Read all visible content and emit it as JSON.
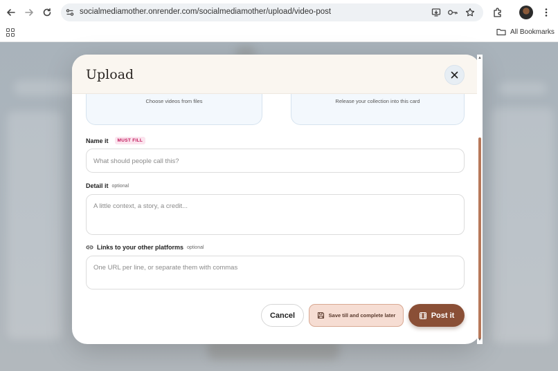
{
  "browser": {
    "url": "socialmediamother.onrender.com/socialmediamother/upload/video-post",
    "all_bookmarks": "All Bookmarks"
  },
  "modal": {
    "title": "Upload",
    "drop_zones": [
      {
        "label": "Choose videos from files"
      },
      {
        "label": "Release your collection into this card"
      }
    ],
    "fields": {
      "name": {
        "label": "Name it",
        "badge": "MUST FILL",
        "placeholder": "What should people call this?"
      },
      "detail": {
        "label": "Detail it",
        "hint": "optional",
        "placeholder": "A little context, a story, a credit..."
      },
      "links": {
        "label": "Links to your other platforms",
        "hint": "optional",
        "placeholder": "One URL per line, or separate them with commas"
      }
    },
    "buttons": {
      "cancel": "Cancel",
      "save_later": "Save till and complete later",
      "post": "Post it"
    }
  },
  "colors": {
    "accent": "#8a4f36",
    "save_bg": "#f6ddd3",
    "must_fill": "#c2185b"
  }
}
